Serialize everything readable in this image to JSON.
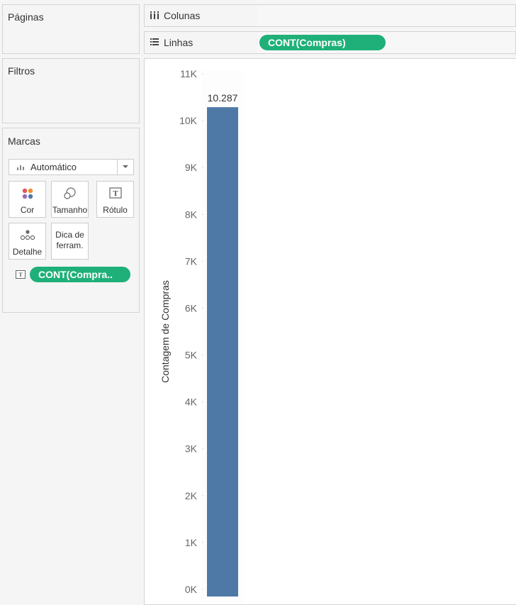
{
  "panels": {
    "pages_title": "Páginas",
    "filters_title": "Filtros",
    "marks_title": "Marcas"
  },
  "marks": {
    "mark_type": "Automático",
    "cards": {
      "color": "Cor",
      "size": "Tamanho",
      "label": "Rótulo",
      "detail": "Detalhe",
      "tooltip_line1": "Dica de",
      "tooltip_line2": "ferram."
    },
    "field_pill": "CONT(Compra.."
  },
  "shelves": {
    "columns_label": "Colunas",
    "rows_label": "Linhas",
    "rows_pill": "CONT(Compras)"
  },
  "colors": {
    "bar": "#4e79a7",
    "pill": "#1fb07a"
  },
  "chart_data": {
    "type": "bar",
    "categories": [
      ""
    ],
    "values": [
      10287
    ],
    "data_labels": [
      "10.287"
    ],
    "ylabel": "Contagem de Compras",
    "ylim": [
      0,
      11000
    ],
    "yticks": [
      "0K",
      "1K",
      "2K",
      "3K",
      "4K",
      "5K",
      "6K",
      "7K",
      "8K",
      "9K",
      "10K",
      "11K"
    ],
    "grid": false
  }
}
